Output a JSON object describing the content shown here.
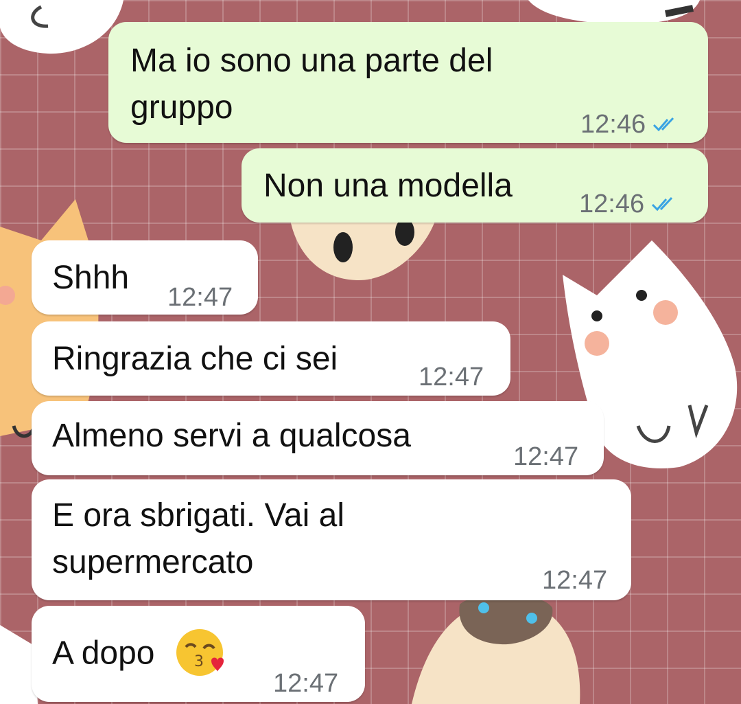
{
  "chat": {
    "messages": [
      {
        "direction": "outgoing",
        "text": "Ma io sono una parte del gruppo",
        "line1": "Ma io sono una parte del",
        "line2": "gruppo",
        "time": "12:46",
        "status": "read"
      },
      {
        "direction": "outgoing",
        "text": "Non una modella",
        "time": "12:46",
        "status": "read"
      },
      {
        "direction": "incoming",
        "text": "Shhh",
        "time": "12:47"
      },
      {
        "direction": "incoming",
        "text": "Ringrazia che ci sei",
        "time": "12:47"
      },
      {
        "direction": "incoming",
        "text": "Almeno servi a qualcosa",
        "time": "12:47"
      },
      {
        "direction": "incoming",
        "text": "E ora sbrigati. Vai al supermercato",
        "line1": "E ora sbrigati. Vai al",
        "line2": "supermercato",
        "time": "12:47"
      },
      {
        "direction": "incoming",
        "text": "A dopo",
        "emoji": "kissing-face-with-heart-emoji",
        "time": "12:47"
      }
    ]
  },
  "colors": {
    "background": "#ab6468",
    "outgoing_bubble": "#e7fbd6",
    "incoming_bubble": "#ffffff",
    "read_tick": "#3aa3e3",
    "timestamp": "#6b7075"
  }
}
